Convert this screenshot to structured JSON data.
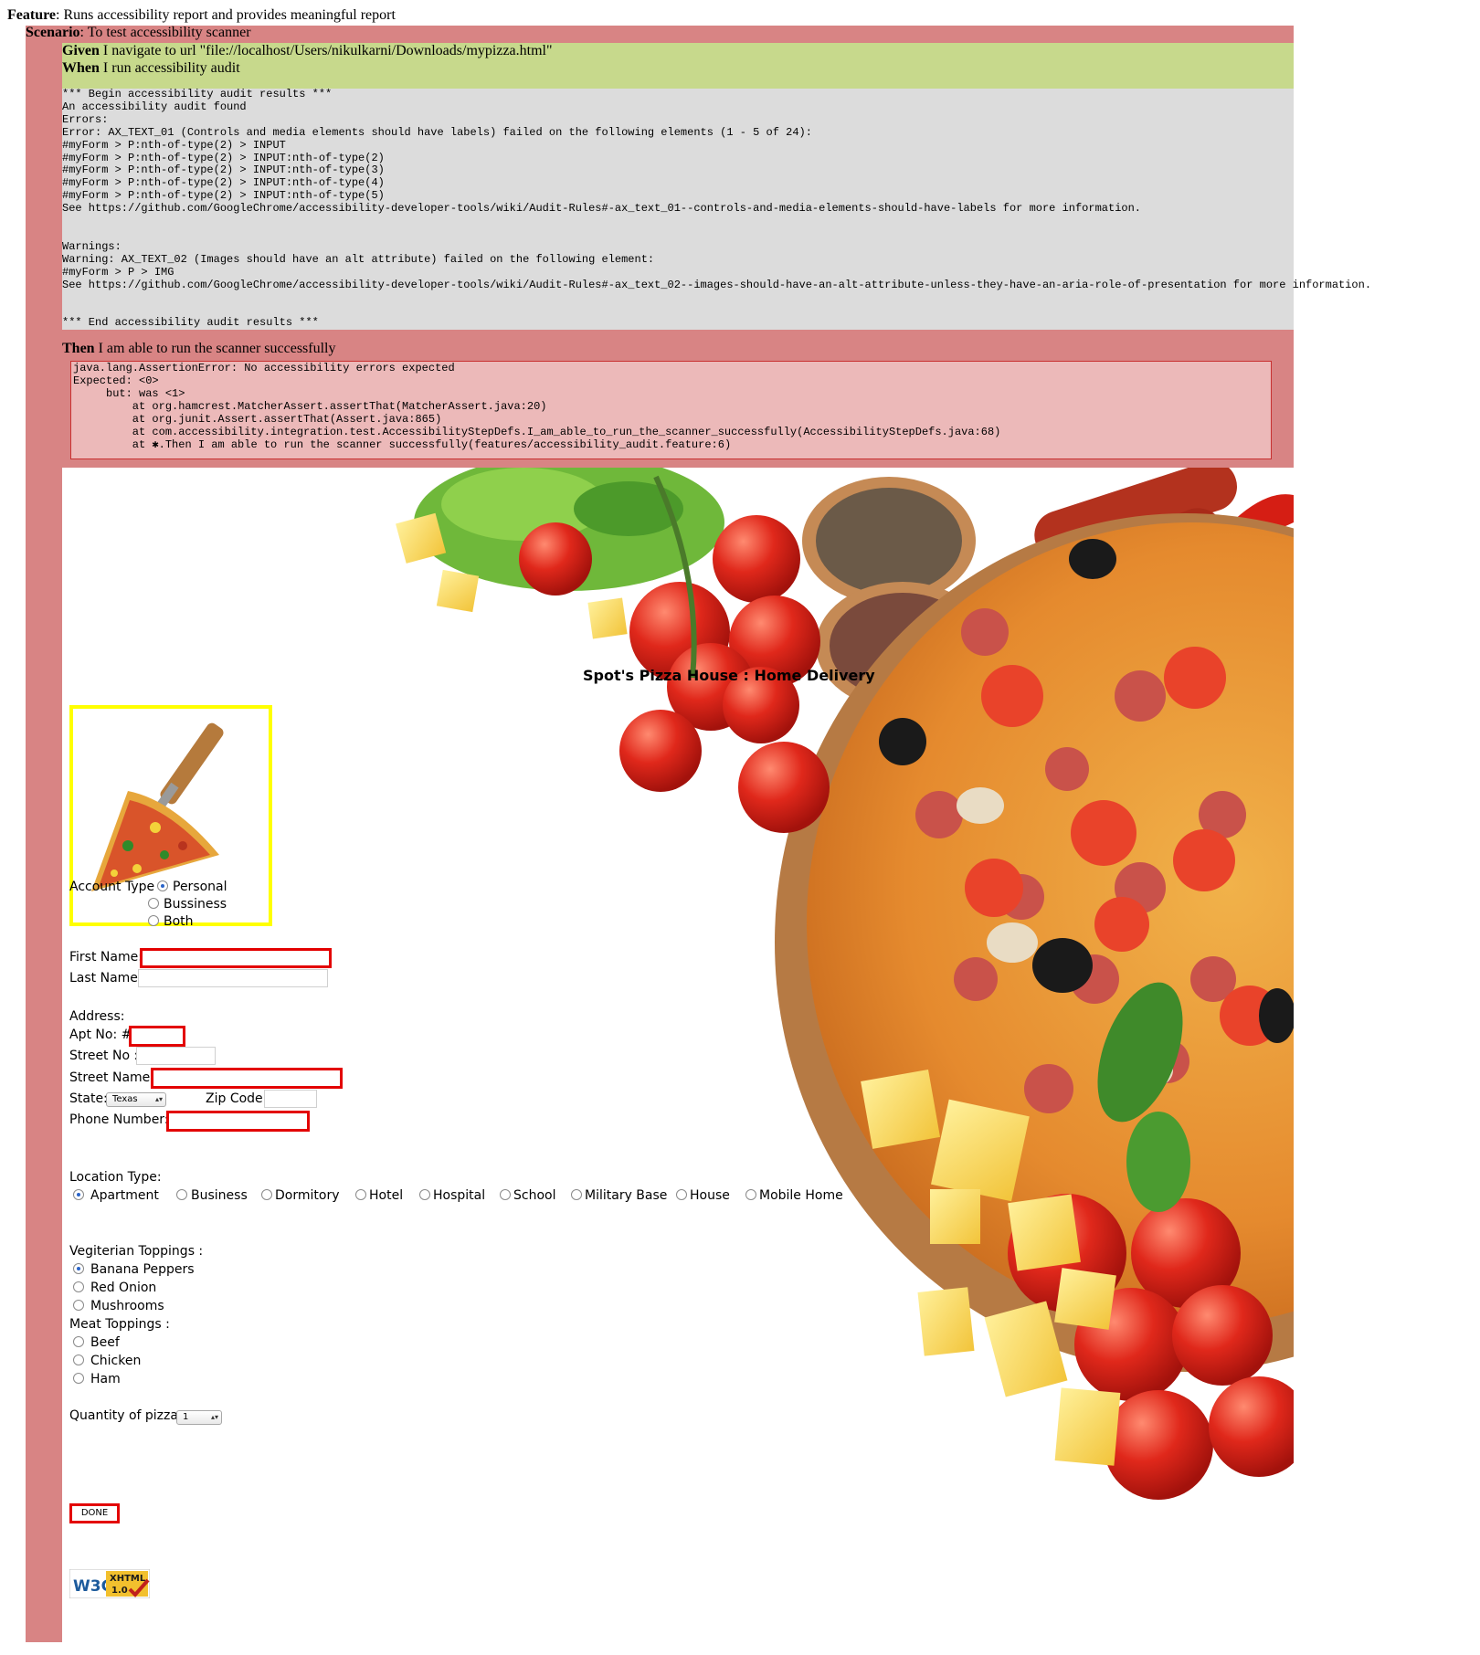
{
  "report": {
    "feature_keyword": "Feature",
    "feature_text": ": Runs accessibility report and provides meaningful report",
    "scenario_keyword": "Scenario",
    "scenario_text": ": To test accessibility scanner",
    "given_keyword": "Given",
    "given_text": " I navigate to url \"file://localhost/Users/nikulkarni/Downloads/mypizza.html\"",
    "when_keyword": "When",
    "when_text": " I run accessibility audit",
    "audit_output": "*** Begin accessibility audit results ***\nAn accessibility audit found\nErrors:\nError: AX_TEXT_01 (Controls and media elements should have labels) failed on the following elements (1 - 5 of 24):\n#myForm > P:nth-of-type(2) > INPUT\n#myForm > P:nth-of-type(2) > INPUT:nth-of-type(2)\n#myForm > P:nth-of-type(2) > INPUT:nth-of-type(3)\n#myForm > P:nth-of-type(2) > INPUT:nth-of-type(4)\n#myForm > P:nth-of-type(2) > INPUT:nth-of-type(5)\nSee https://github.com/GoogleChrome/accessibility-developer-tools/wiki/Audit-Rules#-ax_text_01--controls-and-media-elements-should-have-labels for more information.\n\n\nWarnings:\nWarning: AX_TEXT_02 (Images should have an alt attribute) failed on the following element:\n#myForm > P > IMG\nSee https://github.com/GoogleChrome/accessibility-developer-tools/wiki/Audit-Rules#-ax_text_02--images-should-have-an-alt-attribute-unless-they-have-an-aria-role-of-presentation for more information.\n\n\n*** End accessibility audit results ***",
    "then_keyword": "Then",
    "then_text": " I am able to run the scanner successfully",
    "error_output": "java.lang.AssertionError: No accessibility errors expected\nExpected: <0>\n     but: was <1>\n         at org.hamcrest.MatcherAssert.assertThat(MatcherAssert.java:20)\n         at org.junit.Assert.assertThat(Assert.java:865)\n         at com.accessibility.integration.test.AccessibilityStepDefs.I_am_able_to_run_the_scanner_successfully(AccessibilityStepDefs.java:68)\n         at ✱.Then I am able to run the scanner successfully(features/accessibility_audit.feature:6)"
  },
  "page": {
    "title": "Spot's Pizza House : Home Delivery",
    "account_type": {
      "label": "Account Type :",
      "options": [
        "Personal",
        "Bussiness",
        "Both"
      ],
      "selected": "Personal"
    },
    "first_name_label": "First Name:",
    "last_name_label": "Last Name:",
    "address_label": "Address:",
    "apt_label": "Apt No: #",
    "street_no_label": "Street No :",
    "street_name_label": "Street Name:",
    "state_label": "State:",
    "state_value": "Texas",
    "zip_label": "Zip Code:",
    "phone_label": "Phone Number:",
    "location_type": {
      "label": "Location Type:",
      "options": [
        "Apartment",
        "Business",
        "Dormitory",
        "Hotel",
        "Hospital",
        "School",
        "Military Base",
        "House",
        "Mobile Home"
      ],
      "selected": "Apartment"
    },
    "veg_toppings": {
      "label": "Vegiterian Toppings :",
      "options": [
        "Banana Peppers",
        "Red Onion",
        "Mushrooms"
      ],
      "selected": "Banana Peppers"
    },
    "meat_toppings": {
      "label": "Meat Toppings :",
      "options": [
        "Beef",
        "Chicken",
        "Ham"
      ]
    },
    "quantity_label": "Quantity of pizzas",
    "quantity_value": "1",
    "done_label": "DONE",
    "badge": {
      "w3c": "W3C",
      "xhtml": "XHTML",
      "version": "1.0"
    }
  },
  "colors": {
    "scenario_bg": "#d88484",
    "passed_bg": "#c7d98c",
    "output_bg": "#dcdcdc",
    "error_bg": "#ecb9b9",
    "invalid_outline": "#e30000",
    "image_border": "#ffff00"
  }
}
